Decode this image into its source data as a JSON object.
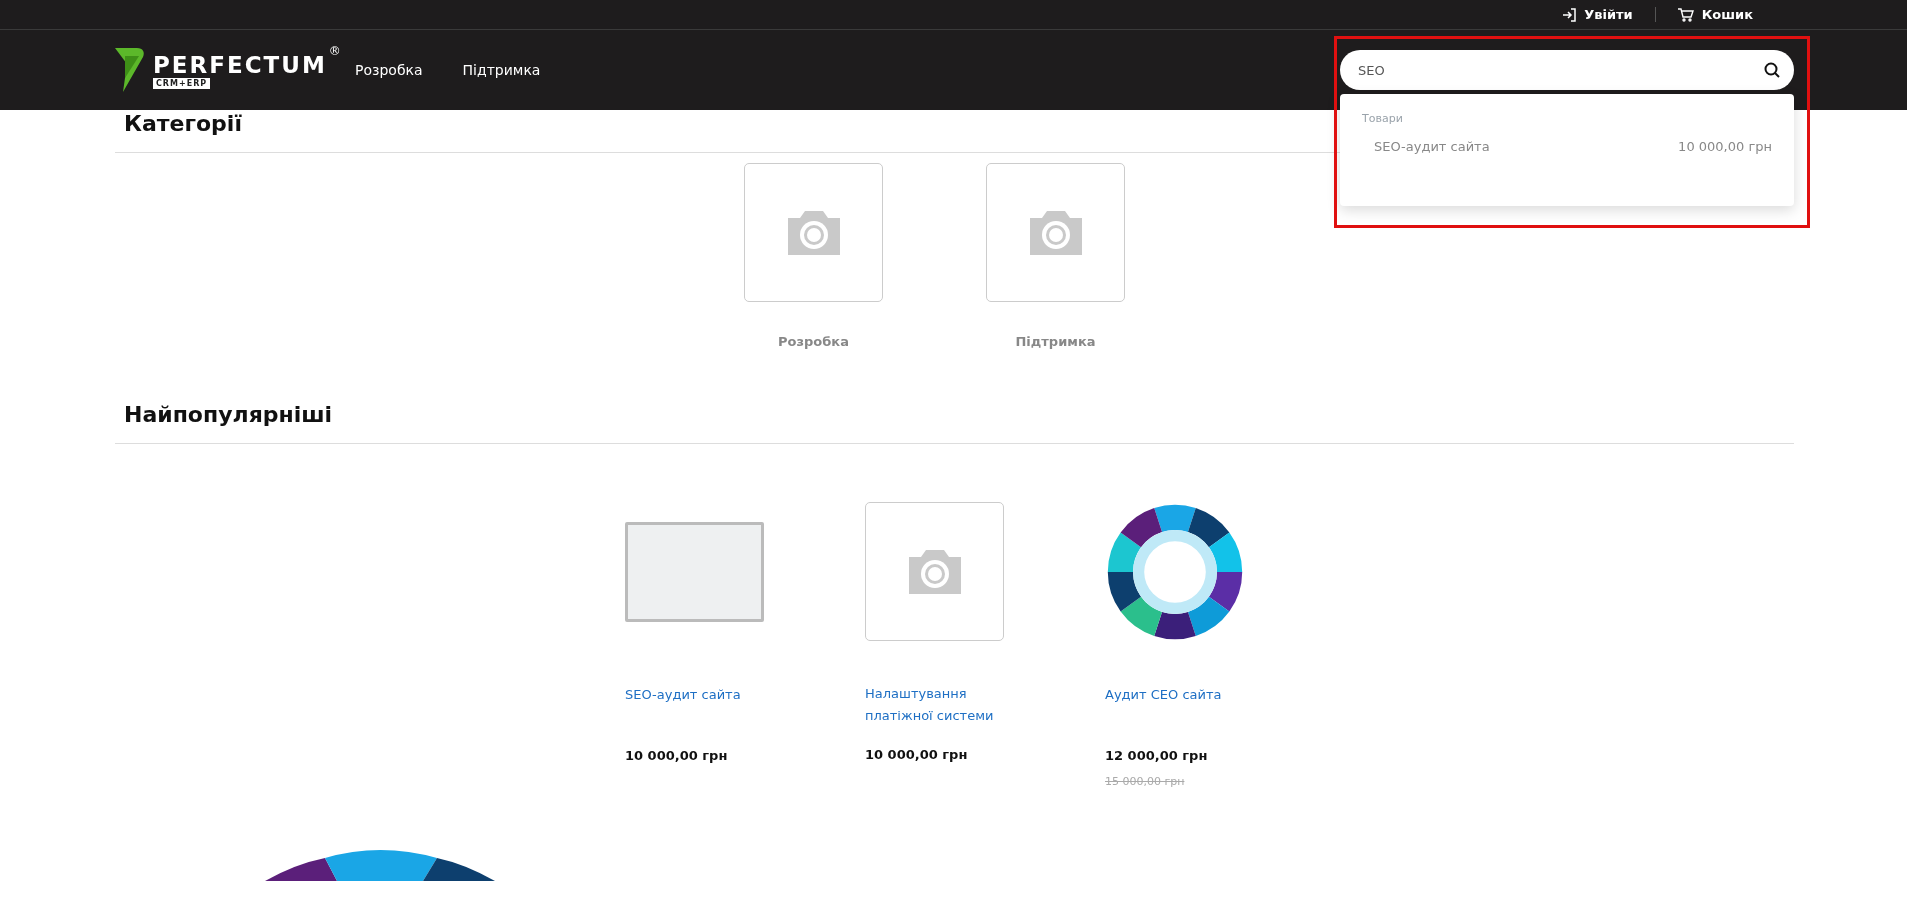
{
  "top_links": [
    {
      "label": "Увійти",
      "kind": "login"
    },
    {
      "label": "Кошик",
      "kind": "cart"
    }
  ],
  "logo": {
    "name": "PERFECTUM",
    "badge": "CRM+ERP",
    "mark": "®"
  },
  "nav": [
    "Розробка",
    "Підтримка"
  ],
  "search": {
    "value": "SEO",
    "highlighted": true,
    "results": {
      "group": "Товари",
      "items": [
        {
          "name": "SEO-аудит сайта",
          "price": "10 000,00 грн"
        }
      ]
    }
  },
  "categories": {
    "title": "Категорії",
    "items": [
      {
        "name": "Розробка",
        "kind": "placeholder"
      },
      {
        "name": "Підтримка",
        "kind": "placeholder"
      }
    ]
  },
  "popular": {
    "title": "Найпопулярніші",
    "products": [
      {
        "name": "SEO-аудит сайта",
        "price": "10 000,00 грн",
        "kind": "photo"
      },
      {
        "name": "Налаштування платіжної системи",
        "price": "10 000,00 грн",
        "kind": "placeholder"
      },
      {
        "name": "Аудит СЕО сайта",
        "price": "12 000,00 грн",
        "old_price": "15 000,00 грн",
        "kind": "wheel"
      }
    ]
  },
  "more": {
    "kind": "wheel"
  }
}
